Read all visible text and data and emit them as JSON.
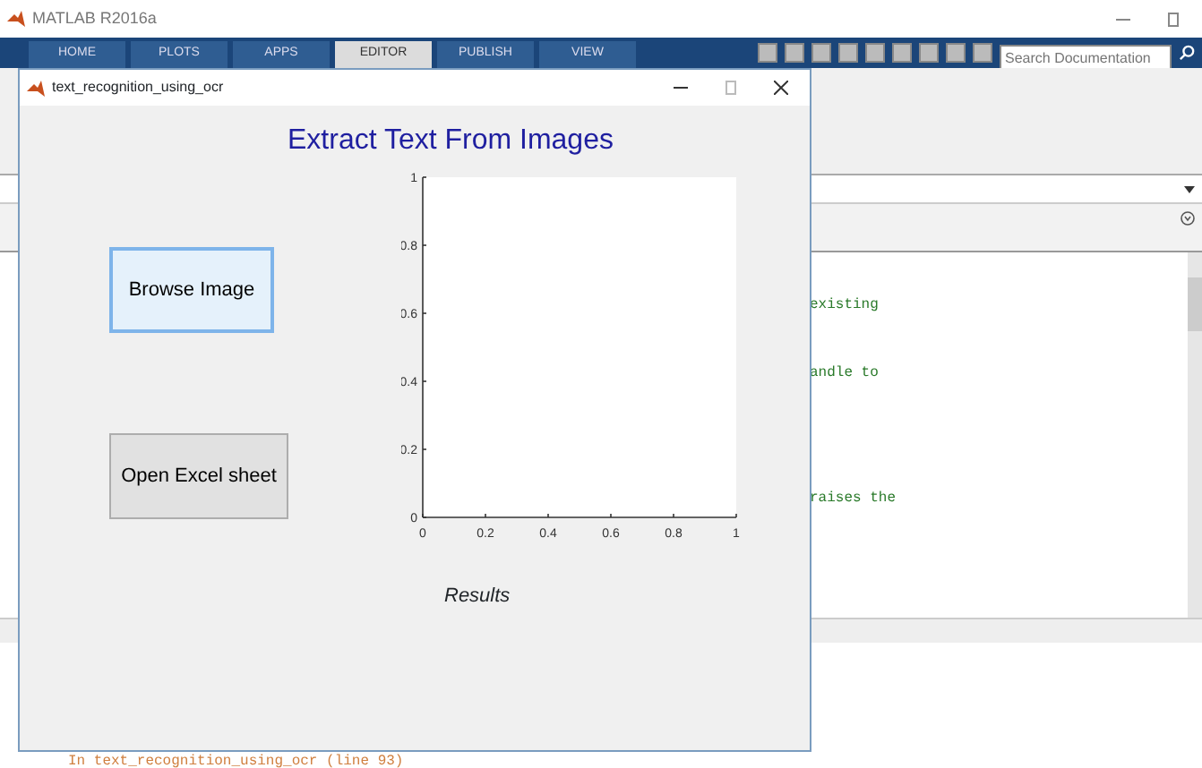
{
  "app_window": {
    "title": "MATLAB R2016a"
  },
  "ribbon_tabs": [
    {
      "label": "HOME",
      "selected": false
    },
    {
      "label": "PLOTS",
      "selected": false
    },
    {
      "label": "APPS",
      "selected": false
    },
    {
      "label": "EDITOR",
      "selected": true
    },
    {
      "label": "PUBLISH",
      "selected": false
    },
    {
      "label": "VIEW",
      "selected": false
    }
  ],
  "search": {
    "placeholder": "Search Documentation"
  },
  "editor_lines": [
    {
      "text": "existing"
    },
    {
      "text": "andle to"
    },
    {
      "text": "raises the"
    }
  ],
  "command_window": {
    "text": "In text_recognition_using_ocr (line 93)"
  },
  "figure_window": {
    "title": "text_recognition_using_ocr",
    "heading": "Extract Text From Images",
    "buttons": [
      {
        "label": "Browse Image",
        "focused": true
      },
      {
        "label": "Open Excel sheet",
        "focused": false
      }
    ],
    "chart_data": {
      "type": "line",
      "xlim": [
        0,
        1
      ],
      "ylim": [
        0,
        1
      ],
      "xticks": [
        0,
        0.2,
        0.4,
        0.6,
        0.8,
        1
      ],
      "yticks": [
        0,
        0.2,
        0.4,
        0.6,
        0.8,
        1
      ]
    },
    "results_label": "Results"
  }
}
